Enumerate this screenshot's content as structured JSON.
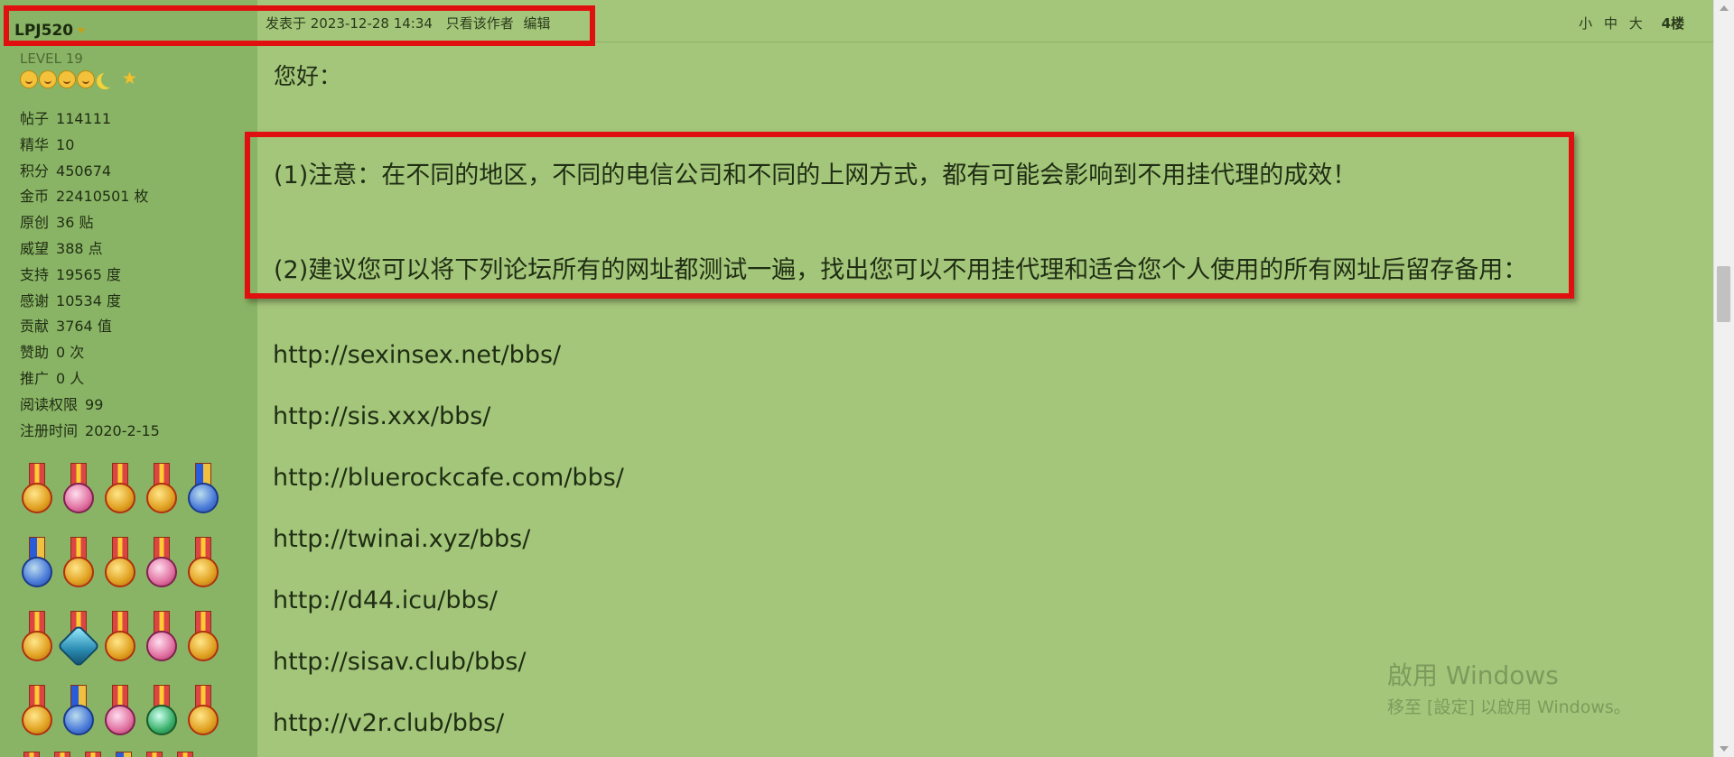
{
  "author": {
    "name": "LPJ520",
    "level": "LEVEL 19",
    "stats": [
      {
        "key": "帖子",
        "value": "114111"
      },
      {
        "key": "精华",
        "value": "10"
      },
      {
        "key": "积分",
        "value": "450674"
      },
      {
        "key": "金币",
        "value": "22410501 枚"
      },
      {
        "key": "原创",
        "value": "36 贴"
      },
      {
        "key": "威望",
        "value": "388 点"
      },
      {
        "key": "支持",
        "value": "19565 度"
      },
      {
        "key": "感谢",
        "value": "10534 度"
      },
      {
        "key": "贡献",
        "value": "3764 值"
      },
      {
        "key": "赞助",
        "value": "0 次"
      },
      {
        "key": "推广",
        "value": "0 人"
      },
      {
        "key": "阅读权限",
        "value": "99"
      },
      {
        "key": "注册时间",
        "value": "2020-2-15"
      }
    ]
  },
  "post": {
    "meta": {
      "posted_label": "发表于 2023-12-28 14:34",
      "only_author": "只看该作者",
      "edit": "编辑"
    },
    "font_sizes": [
      "小",
      "中",
      "大"
    ],
    "floor": "4楼",
    "greeting": "您好：",
    "notice": {
      "line1": "(1)注意：在不同的地区，不同的电信公司和不同的上网方式，都有可能会影响到不用挂代理的成效！",
      "line2": "(2)建议您可以将下列论坛所有的网址都测试一遍，找出您可以不用挂代理和适合您个人使用的所有网址后留存备用："
    },
    "urls": [
      "http://sexinsex.net/bbs/",
      "http://sis.xxx/bbs/",
      "http://bluerockcafe.com/bbs/",
      "http://twinai.xyz/bbs/",
      "http://d44.icu/bbs/",
      "http://sisav.club/bbs/",
      "http://v2r.club/bbs/"
    ]
  },
  "watermark": {
    "line1": "啟用 Windows",
    "line2": "移至 [設定] 以啟用 Windows。"
  },
  "colors": {
    "page_bg": "#a4c67a",
    "sidebar_bg": "#8ab465",
    "highlight_border": "#e11010"
  }
}
